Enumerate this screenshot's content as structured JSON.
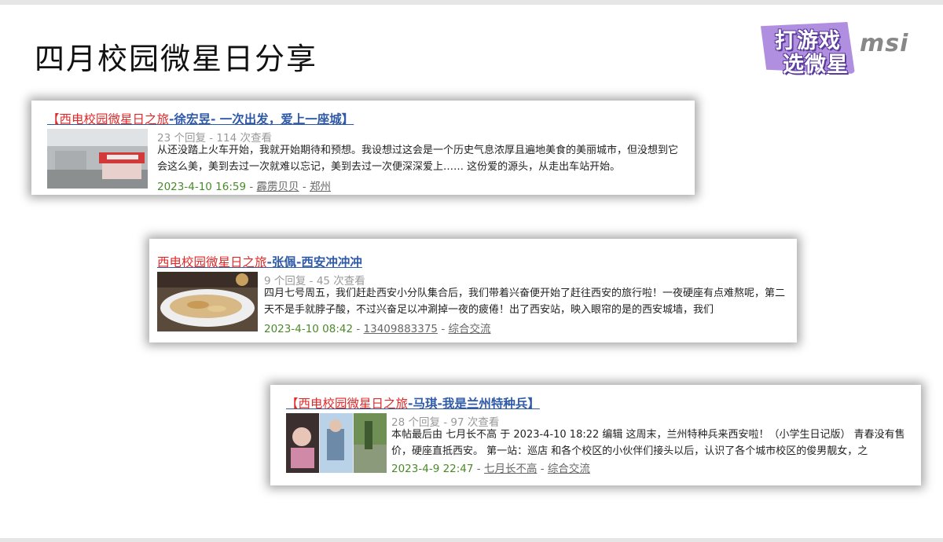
{
  "slide": {
    "title": "四月校园微星日分享"
  },
  "logo": {
    "badge_line1": "打游戏",
    "badge_line2": "选微星",
    "brand": "msi",
    "colors": {
      "badge": "#b18fe0",
      "outline": "#5a3a9a",
      "brand": "#888888"
    }
  },
  "posts": [
    {
      "title_prefix": "【西电校园微星日之旅",
      "title_suffix": "-徐宏昱- 一次出发，爱上一座城】",
      "stats": "23 个回复 - 114 次查看",
      "excerpt": "从还没踏上火车开始，我就开始期待和预想。我设想过这会是一个历史气息浓厚且遍地美食的美丽城市，但没想到它会这么美，美到去过一次就难以忘记，美到去过一次便深深爱上…… 这份爱的源头，从走出车站开始。",
      "date": "2023-4-10 16:59",
      "author": "霹雳贝贝",
      "forum": "郑州",
      "thumb_icon": "storefront-photo"
    },
    {
      "title_prefix": "西电校园微星日之旅",
      "title_suffix": "-张佩-西安冲冲冲",
      "stats": "9 个回复 - 45 次查看",
      "excerpt": "四月七号周五，我们赶赴西安小分队集合后，我们带着兴奋便开始了赶往西安的旅行啦！一夜硬座有点难熬呢，第二天不是手就脖子酸，不过兴奋足以冲涮掉一夜的疲倦！出了西安站，映入眼帘的是的西安城墙，我们",
      "date": "2023-4-10 08:42",
      "author": "13409883375",
      "forum": "综合交流",
      "thumb_icon": "food-plate-photo"
    },
    {
      "title_prefix": "【西电校园微星日之旅",
      "title_suffix": "-马琪-我是兰州特种兵】",
      "stats": "28 个回复 - 97 次查看",
      "excerpt": "本帖最后由 七月长不高 于 2023-4-10 18:22 编辑 这周末，兰州特种兵来西安啦！（小学生日记版） 青春没有售价，硬座直抵西安。 第一站：巡店 和各个校区的小伙伴们接头以后，认识了各个城市校区的俊男靓女，之",
      "date": "2023-4-9 22:47",
      "author": "七月长不高",
      "forum": "综合交流",
      "thumb_icon": "collage-photo"
    }
  ],
  "colors": {
    "title_link": "#2f5aa8",
    "title_red": "#e02a2a",
    "date_green": "#4a8a2a",
    "stats_gray": "#999999"
  }
}
